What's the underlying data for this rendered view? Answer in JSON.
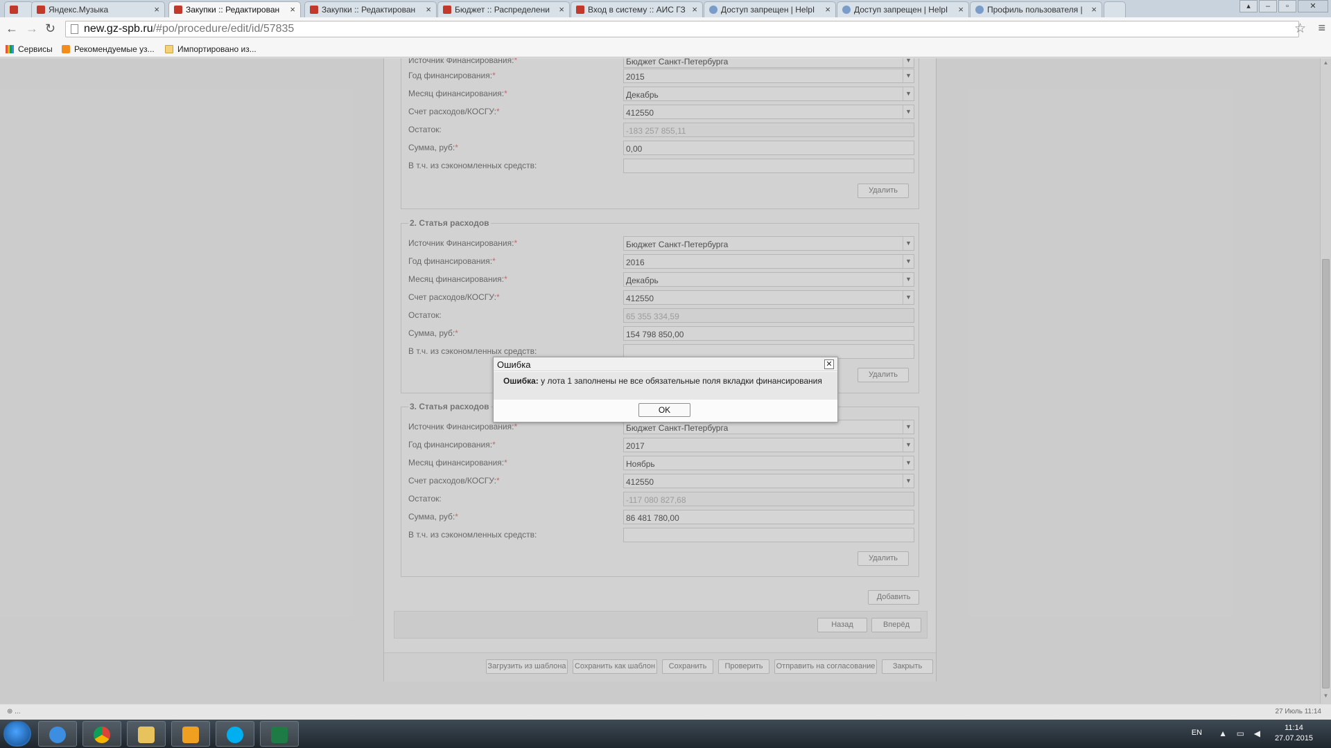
{
  "browser": {
    "tabs": [
      {
        "label": "",
        "icon": "yandex-music-icon"
      },
      {
        "label": "Яндекс.Музыка",
        "icon": "yandex-music-icon"
      },
      {
        "label": "Закупки :: Редактирован",
        "icon": "hammer-icon",
        "active": true
      },
      {
        "label": "Закупки :: Редактирован",
        "icon": "hammer-icon"
      },
      {
        "label": "Бюджет :: Распределени",
        "icon": "hammer-icon"
      },
      {
        "label": "Вход в систему :: АИС ГЗ",
        "icon": "hammer-icon"
      },
      {
        "label": "Доступ запрещен | HelpI",
        "icon": "globe-icon"
      },
      {
        "label": "Доступ запрещен | HelpI",
        "icon": "globe-icon"
      },
      {
        "label": "Профиль пользователя |",
        "icon": "globe-icon"
      }
    ],
    "url_host": "new.gz-spb.ru",
    "url_path": "/#po/procedure/edit/id/57835",
    "bookmarks": [
      "Сервисы",
      "Рекомендуемые уз...",
      "Импортировано из..."
    ]
  },
  "form": {
    "sections": [
      {
        "legend": "",
        "rows": [
          {
            "label": "Источник Финансирования:",
            "required": true,
            "value": "Бюджет Санкт-Петербурга",
            "type": "select"
          },
          {
            "label": "Год финансирования:",
            "required": true,
            "value": "2015",
            "type": "select"
          },
          {
            "label": "Месяц финансирования:",
            "required": true,
            "value": "Декабрь",
            "type": "select"
          },
          {
            "label": "Счет расходов/КОСГУ:",
            "required": true,
            "value": "412550",
            "type": "select"
          },
          {
            "label": "Остаток:",
            "required": false,
            "value": "-183 257 855,11",
            "type": "readonly"
          },
          {
            "label": "Сумма, руб:",
            "required": true,
            "value": "0,00",
            "type": "input"
          },
          {
            "label": "В т.ч. из сэкономленных средств:",
            "required": false,
            "value": "",
            "type": "input"
          }
        ],
        "delete_label": "Удалить"
      },
      {
        "legend": "2. Статья расходов",
        "rows": [
          {
            "label": "Источник Финансирования:",
            "required": true,
            "value": "Бюджет Санкт-Петербурга",
            "type": "select"
          },
          {
            "label": "Год финансирования:",
            "required": true,
            "value": "2016",
            "type": "select"
          },
          {
            "label": "Месяц финансирования:",
            "required": true,
            "value": "Декабрь",
            "type": "select"
          },
          {
            "label": "Счет расходов/КОСГУ:",
            "required": true,
            "value": "412550",
            "type": "select"
          },
          {
            "label": "Остаток:",
            "required": false,
            "value": "65 355 334,59",
            "type": "readonly"
          },
          {
            "label": "Сумма, руб:",
            "required": true,
            "value": "154 798 850,00",
            "type": "input"
          },
          {
            "label": "В т.ч. из сэкономленных средств:",
            "required": false,
            "value": "",
            "type": "input"
          }
        ],
        "delete_label": "Удалить"
      },
      {
        "legend": "3. Статья расходов",
        "rows": [
          {
            "label": "Источник Финансирования:",
            "required": true,
            "value": "Бюджет Санкт-Петербурга",
            "type": "select"
          },
          {
            "label": "Год финансирования:",
            "required": true,
            "value": "2017",
            "type": "select"
          },
          {
            "label": "Месяц финансирования:",
            "required": true,
            "value": "Ноябрь",
            "type": "select"
          },
          {
            "label": "Счет расходов/КОСГУ:",
            "required": true,
            "value": "412550",
            "type": "select"
          },
          {
            "label": "Остаток:",
            "required": false,
            "value": "-117 080 827,68",
            "type": "readonly"
          },
          {
            "label": "Сумма, руб:",
            "required": true,
            "value": "86 481 780,00",
            "type": "input"
          },
          {
            "label": "В т.ч. из сэкономленных средств:",
            "required": false,
            "value": "",
            "type": "input"
          }
        ],
        "delete_label": "Удалить"
      }
    ],
    "add_label": "Добавить",
    "back_label": "Назад",
    "forward_label": "Вперёд",
    "actions": [
      "Загрузить из шаблона",
      "Сохранить как шаблон",
      "Сохранить",
      "Проверить",
      "Отправить на согласование",
      "Закрыть"
    ]
  },
  "dialog": {
    "title": "Ошибка",
    "message_prefix": "Ошибка:",
    "message": " у лота 1 заполнены не все обязательные поля вкладки финансирования",
    "ok_label": "OK"
  },
  "statusbar": {
    "left": "⊕ ...",
    "right": "27 Июль 11:14"
  },
  "taskbar": {
    "apps": [
      "internet-explorer-icon",
      "chrome-icon",
      "file-explorer-icon",
      "outlook-icon",
      "skype-icon",
      "excel-icon"
    ],
    "lang": "EN",
    "time": "11:14",
    "date": "27.07.2015"
  },
  "colors": {
    "required_marker": "#d86a6a",
    "taskbar": "#2b343c"
  }
}
